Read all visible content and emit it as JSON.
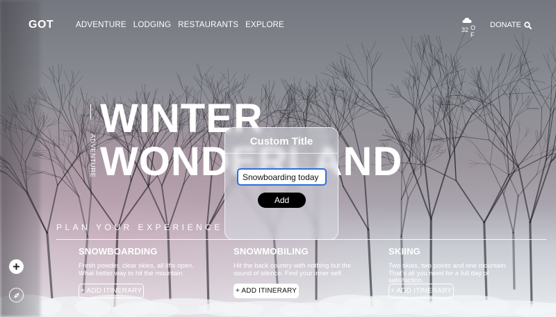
{
  "nav": {
    "logo": "GOT",
    "menu": [
      "ADVENTURE",
      "LODGING",
      "RESTAURANTS",
      "EXPLORE"
    ],
    "weather": {
      "temp": "32",
      "unit": "O F",
      "icon": "cloud-snow-icon"
    },
    "donate": "DONATE"
  },
  "hero": {
    "line1": "WINTER",
    "line2": "WONDERLAND",
    "vertical": "ADVENTURE"
  },
  "modal": {
    "title": "Custom Title",
    "input_value": "Snowboarding today",
    "add_label": "Add"
  },
  "plan": {
    "heading": "PLAN YOUR EXPERIENCE",
    "cards": [
      {
        "title": "SNOWBOARDING",
        "desc": "Fresh powder, clear skies, all lifts open. What better way to hit the mountain.",
        "button": "+ ADD ITINERARY"
      },
      {
        "title": "SNOWMOBILING",
        "desc": "Hit the back country with nothing but the sound of silence. Find your inner self.",
        "button": "+ ADD ITINERARY"
      },
      {
        "title": "SKIING",
        "desc": "Two skies, two points and one mountain. That's all you need for a full day of satisfaction.",
        "button": "+ ADD ITINERARY"
      }
    ]
  },
  "side": {
    "plus_icon": "plus-icon",
    "compass_icon": "compass-icon"
  }
}
